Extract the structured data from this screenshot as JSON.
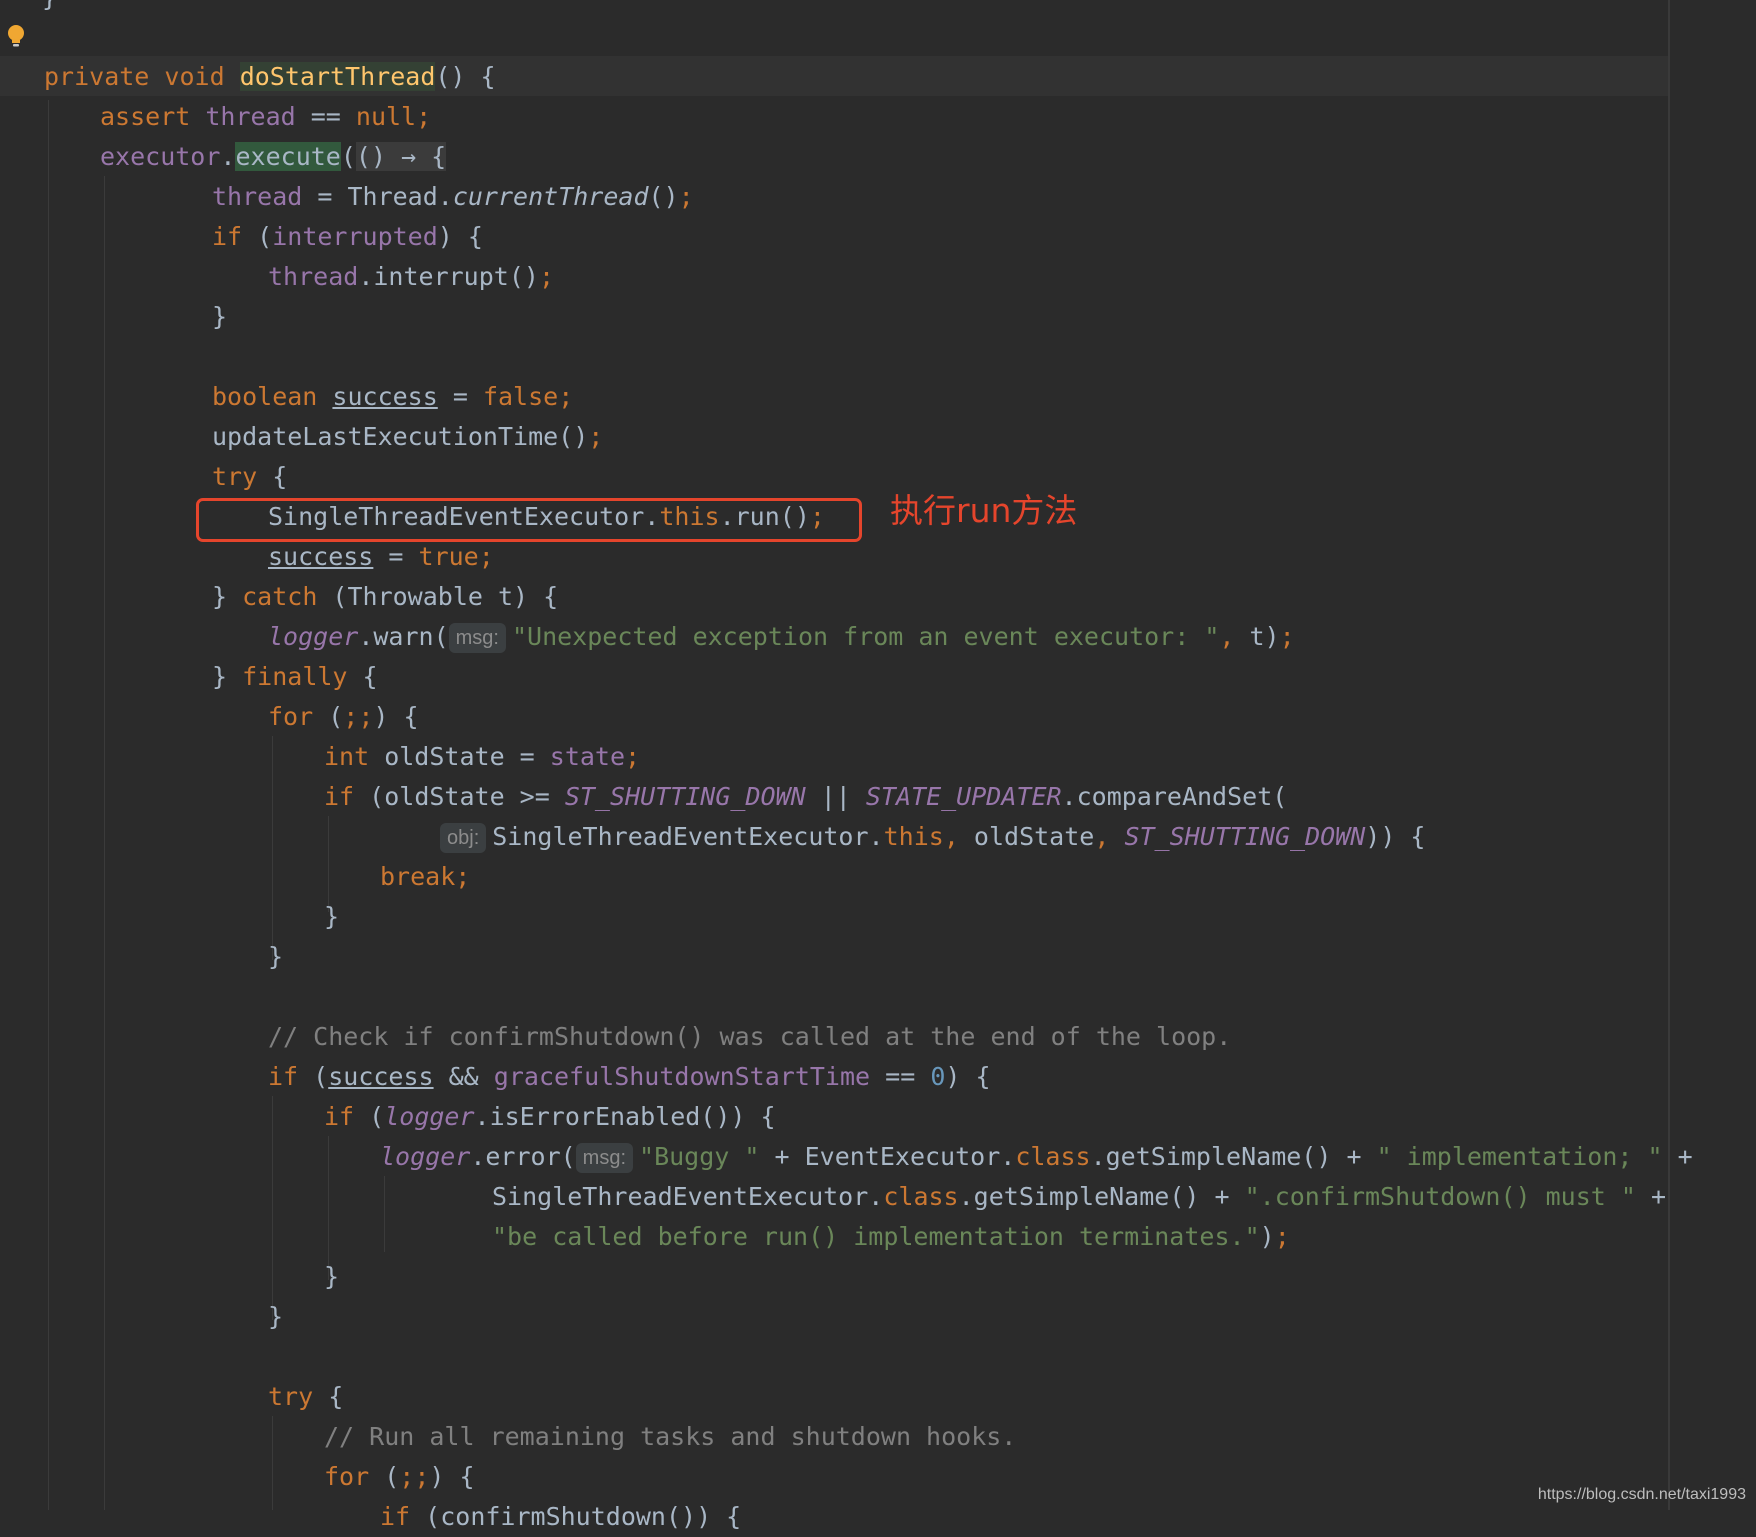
{
  "editor": {
    "top_brace": "}",
    "lines": {
      "l1": {
        "p1": "private",
        "p2": " ",
        "p3": "void",
        "p4": " ",
        "p5": "doStartThread",
        "p6": "() {"
      },
      "l2": {
        "p1": "assert",
        "p2": " ",
        "p3": "thread",
        "p4": " == ",
        "p5": "null",
        "p6": ";"
      },
      "l3": {
        "p1": "executor",
        "p2": ".",
        "p3": "execute",
        "p4": "(",
        "p5": "() → {"
      },
      "l4": {
        "p1": "thread",
        "p2": " = Thread.",
        "p3": "currentThread",
        "p4": "()",
        "p5": ";"
      },
      "l5": {
        "p1": "if",
        "p2": " (",
        "p3": "interrupted",
        "p4": ") {"
      },
      "l6": {
        "p1": "thread",
        "p2": ".interrupt()",
        "p3": ";"
      },
      "l7": {
        "p1": "}"
      },
      "l8": {
        "p1": "boolean",
        "p2": " ",
        "p3": "success",
        "p4": " = ",
        "p5": "false",
        "p6": ";"
      },
      "l9": {
        "p1": "updateLastExecutionTime()",
        "p2": ";"
      },
      "l10": {
        "p1": "try",
        "p2": " {"
      },
      "l11": {
        "p1": "SingleThreadEventExecutor.",
        "p2": "this",
        "p3": ".run()",
        "p4": ";"
      },
      "l12": {
        "p1": "success",
        "p2": " = ",
        "p3": "true",
        "p4": ";"
      },
      "l13": {
        "p1": "} ",
        "p2": "catch",
        "p3": " (Throwable t) {"
      },
      "l14": {
        "p1": "logger",
        "p2": ".warn(",
        "hint": "msg:",
        "p3": "\"Unexpected exception from an event executor: \"",
        "p4": ", ",
        "p5": "t)",
        "p6": ";"
      },
      "l15": {
        "p1": "} ",
        "p2": "finally",
        "p3": " {"
      },
      "l16": {
        "p1": "for",
        "p2": " (",
        "p3": ";;",
        "p4": ") {"
      },
      "l17": {
        "p1": "int",
        "p2": " oldState = ",
        "p3": "state",
        "p4": ";"
      },
      "l18": {
        "p1": "if",
        "p2": " (oldState >= ",
        "p3": "ST_SHUTTING_DOWN",
        "p4": " || ",
        "p5": "STATE_UPDATER",
        "p6": ".compareAndSet("
      },
      "l19": {
        "hint": "obj:",
        "p1": "SingleThreadEventExecutor.",
        "p2": "this",
        "p3": ", ",
        "p4": "oldState",
        "p5": ", ",
        "p6": "ST_SHUTTING_DOWN",
        "p7": ")) {"
      },
      "l20": {
        "p1": "break",
        "p2": ";"
      },
      "l21": {
        "p1": "}"
      },
      "l22": {
        "p1": "}"
      },
      "l23": {
        "p1": "// Check if confirmShutdown() was called at the end of the loop."
      },
      "l24": {
        "p1": "if",
        "p2": " (",
        "p3": "success",
        "p4": " && ",
        "p5": "gracefulShutdownStartTime",
        "p6": " == ",
        "p7": "0",
        "p8": ") {"
      },
      "l25": {
        "p1": "if",
        "p2": " (",
        "p3": "logger",
        "p4": ".isErrorEnabled()) {"
      },
      "l26": {
        "p1": "logger",
        "p2": ".error(",
        "hint": "msg:",
        "p3": "\"Buggy \"",
        "p4": " + EventExecutor.",
        "p5": "class",
        "p6": ".getSimpleName() + ",
        "p7": "\" implementation; \"",
        "p8": " +"
      },
      "l27": {
        "p1": "SingleThreadEventExecutor.",
        "p2": "class",
        "p3": ".getSimpleName() + ",
        "p4": "\".confirmShutdown() must \"",
        "p5": " +"
      },
      "l28": {
        "p1": "\"be called before run() implementation terminates.\"",
        "p2": ")",
        "p3": ";"
      },
      "l29": {
        "p1": "}"
      },
      "l30": {
        "p1": "}"
      },
      "l31": {
        "p1": "try",
        "p2": " {"
      },
      "l32": {
        "p1": "// Run all remaining tasks and shutdown hooks."
      },
      "l33": {
        "p1": "for",
        "p2": " (",
        "p3": ";;",
        "p4": ") {"
      },
      "l34": {
        "p1": "if",
        "p2": " (confirmShutdown()) {"
      }
    }
  },
  "annotation": {
    "label": "执行run方法",
    "color": "#e5452c"
  },
  "watermark": "https://blog.csdn.net/taxi1993",
  "icons": {
    "gutter": "lightbulb-icon"
  },
  "theme": {
    "background": "#2b2b2b",
    "keyword": "#cc7832",
    "method_declaration": "#ffc66d",
    "field": "#9876aa",
    "string": "#6a8759",
    "number": "#6897bb",
    "comment": "#808080",
    "default_text": "#a9b7c6"
  }
}
